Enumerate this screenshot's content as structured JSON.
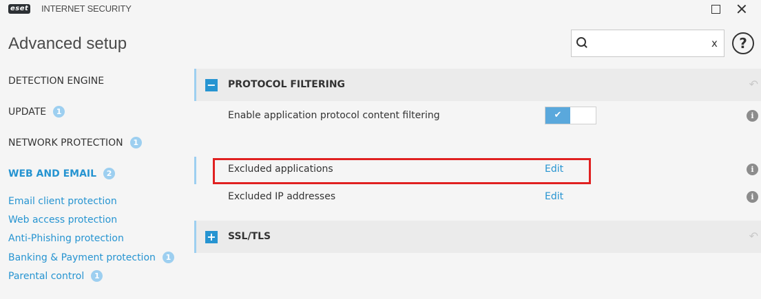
{
  "titlebar": {
    "logo": "eset",
    "product": "INTERNET SECURITY",
    "maximize_icon": "maximize-icon",
    "close_icon": "close-icon"
  },
  "page_title": "Advanced setup",
  "search": {
    "value": "",
    "placeholder": "",
    "clear_glyph": "x",
    "help_glyph": "?"
  },
  "sidebar": {
    "items": [
      {
        "label": "DETECTION ENGINE",
        "badge": ""
      },
      {
        "label": "UPDATE",
        "badge": "1"
      },
      {
        "label": "NETWORK PROTECTION",
        "badge": "1"
      },
      {
        "label": "WEB AND EMAIL",
        "badge": "2",
        "active": true
      }
    ],
    "subitems": [
      {
        "label": "Email client protection",
        "badge": ""
      },
      {
        "label": "Web access protection",
        "badge": ""
      },
      {
        "label": "Anti-Phishing protection",
        "badge": ""
      },
      {
        "label": "Banking & Payment protection",
        "badge": "1"
      },
      {
        "label": "Parental control",
        "badge": "1"
      }
    ]
  },
  "sections": {
    "protocol_filtering": {
      "title": "PROTOCOL FILTERING",
      "toggle_glyph": "−",
      "expanded": true
    },
    "ssl_tls": {
      "title": "SSL/TLS",
      "toggle_glyph": "+",
      "expanded": false
    }
  },
  "settings": {
    "enable_filtering": {
      "label": "Enable application protocol content filtering",
      "enabled": true,
      "check_glyph": "✔"
    },
    "excluded_apps": {
      "label": "Excluded applications",
      "action": "Edit"
    },
    "excluded_ips": {
      "label": "Excluded IP addresses",
      "action": "Edit"
    }
  },
  "info_glyph": "i",
  "revert_glyph": "↶",
  "colors": {
    "accent": "#2694d1",
    "badge": "#9dcff0",
    "highlight": "#e02020"
  }
}
